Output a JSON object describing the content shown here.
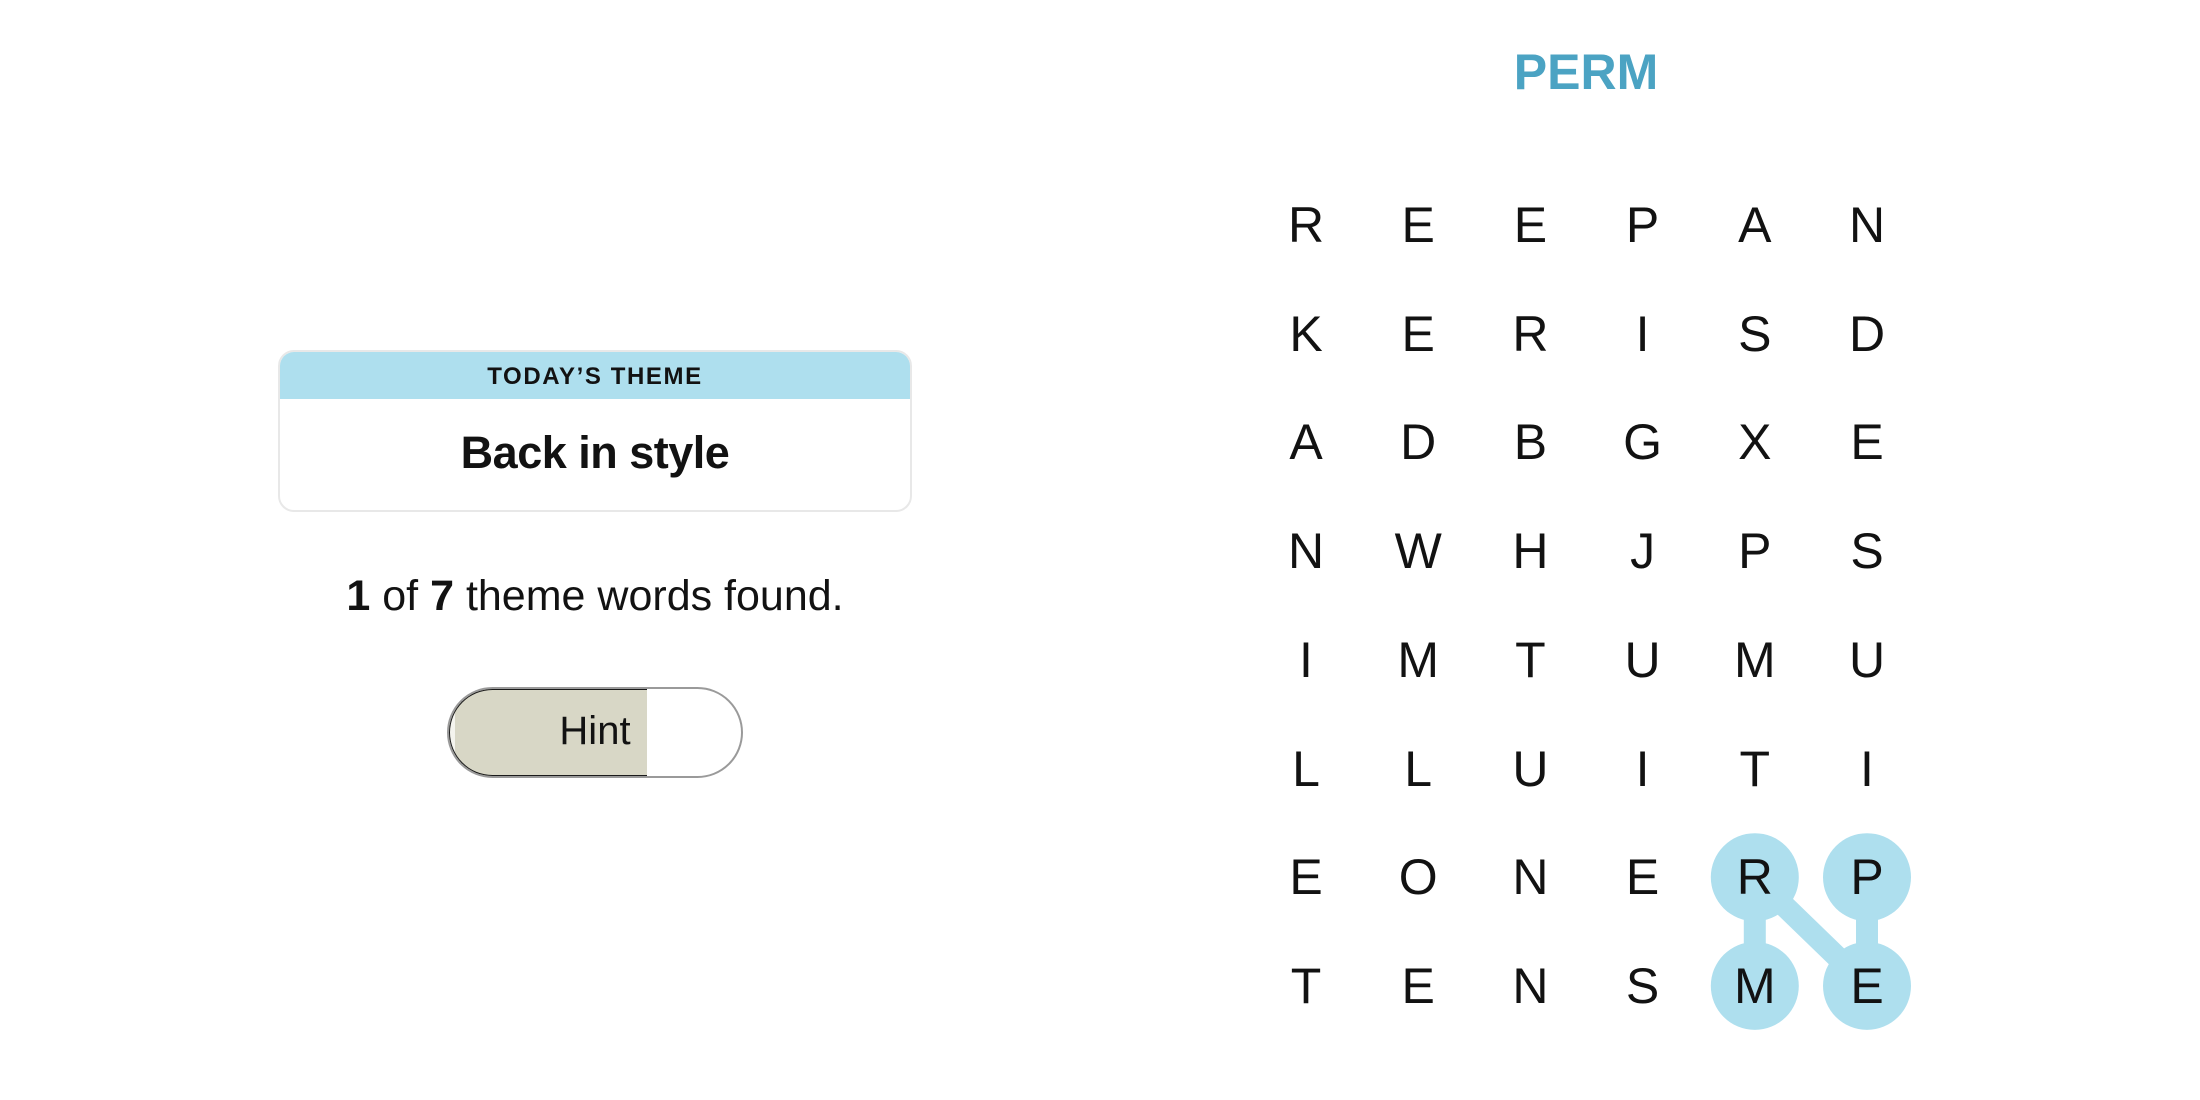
{
  "theme": {
    "header_label": "TODAY’S THEME",
    "title": "Back in style"
  },
  "progress": {
    "found": "1",
    "of_text": " of ",
    "total": "7",
    "suffix": " theme words found."
  },
  "hint": {
    "label": "Hint",
    "fill_fraction": 0.67
  },
  "current_word": "PERM",
  "grid": {
    "rows": 8,
    "cols": 6,
    "letters": [
      [
        "R",
        "E",
        "E",
        "P",
        "A",
        "N"
      ],
      [
        "K",
        "E",
        "R",
        "I",
        "S",
        "D"
      ],
      [
        "A",
        "D",
        "B",
        "G",
        "X",
        "E"
      ],
      [
        "N",
        "W",
        "H",
        "J",
        "P",
        "S"
      ],
      [
        "I",
        "M",
        "T",
        "U",
        "M",
        "U"
      ],
      [
        "L",
        "L",
        "U",
        "I",
        "T",
        "I"
      ],
      [
        "E",
        "O",
        "N",
        "E",
        "R",
        "P"
      ],
      [
        "T",
        "E",
        "N",
        "S",
        "M",
        "E"
      ]
    ]
  },
  "selection": {
    "word": "PERM",
    "path": [
      [
        6,
        5
      ],
      [
        7,
        5
      ],
      [
        6,
        4
      ],
      [
        7,
        4
      ]
    ]
  },
  "colors": {
    "selection": "#aedfee",
    "current_word": "#4ba3c3",
    "theme_header": "#aedfee",
    "hint_fill": "#d8d7c6",
    "letter": "#121212"
  }
}
